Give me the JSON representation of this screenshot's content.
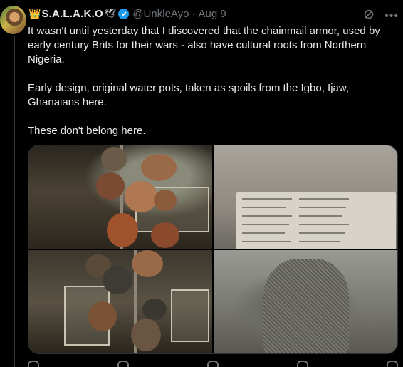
{
  "tweet": {
    "author_crown": "👑",
    "author_name": "S.A.L.A.K.O",
    "author_dove": "🕊",
    "handle": "@UnkleAyo",
    "separator": "·",
    "date": "Aug 9",
    "paragraphs": [
      "It wasn't until yesterday that I discovered that the chainmail armor, used by early century Brits for their wars - also have cultural roots from Northern Nigeria.",
      "Early design, original water pots, taken as spoils from the Igbo, Ijaw, Ghanaians here.",
      "These don't belong here."
    ],
    "media": [
      {
        "alt": "museum-pots-photo"
      },
      {
        "alt": "museum-label-photo"
      },
      {
        "alt": "museum-pots-photo-2"
      },
      {
        "alt": "chainmail-armor-photo"
      }
    ],
    "icons": {
      "verified": "verified-badge-icon",
      "grok": "grok-icon",
      "more": "more-icon"
    },
    "colors": {
      "background": "#000000",
      "text": "#e7e9ea",
      "muted": "#71767b",
      "verified": "#1d9bf0"
    }
  }
}
